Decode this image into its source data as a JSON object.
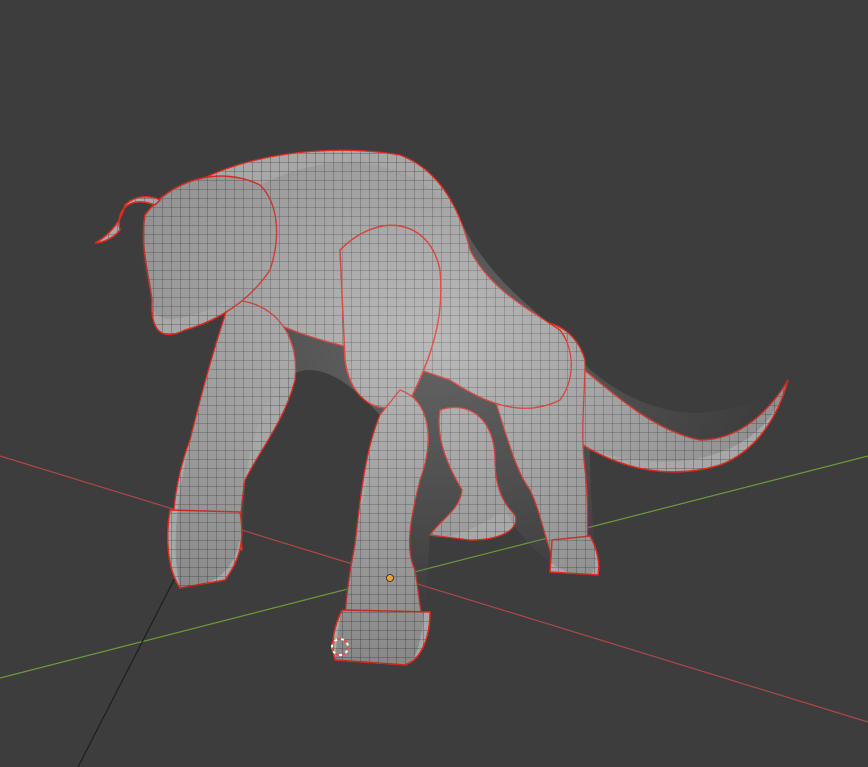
{
  "viewport": {
    "background": "#3d3d3d",
    "x_axis_color": "#b04646",
    "y_axis_color": "#6c9a3a",
    "z_axis_color": "#1e1e1e",
    "seam_color": "#e02a1e",
    "mesh_fill": "#a9a9a9",
    "wire_color": "#4a4a4a",
    "origin_dot_color": "#f0a030",
    "cursor_color": "#e05050"
  },
  "model": {
    "mode": "edit",
    "shading": "solid-with-wireframe-overlay",
    "selected_edges_shown": true
  }
}
